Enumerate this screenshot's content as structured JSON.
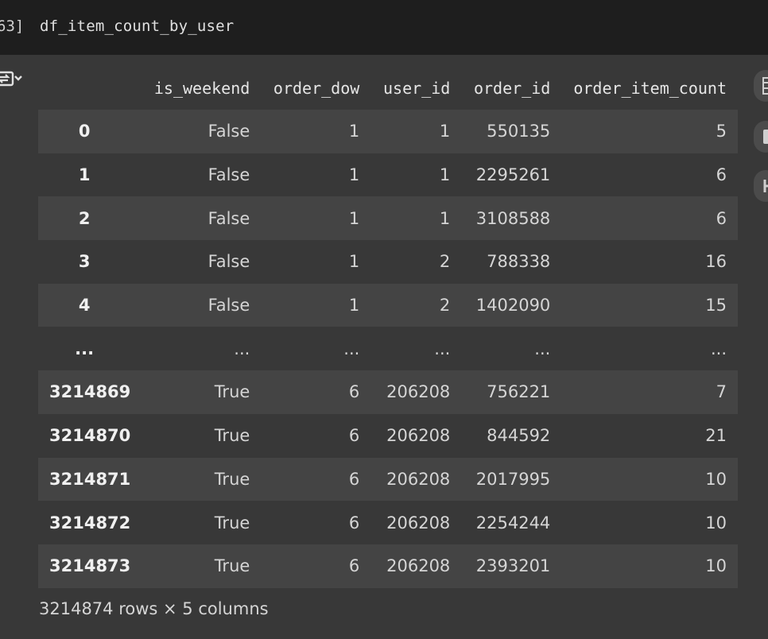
{
  "cell": {
    "exec_count": "63]",
    "code": "df_item_count_by_user"
  },
  "icons": {
    "output_toggle": "output-view-icon",
    "right_side": [
      "table-icon",
      "notebook-icon",
      "chart-icon"
    ]
  },
  "table": {
    "columns": [
      "",
      "is_weekend",
      "order_dow",
      "user_id",
      "order_id",
      "order_item_count"
    ],
    "rows": [
      [
        "0",
        "False",
        "1",
        "1",
        "550135",
        "5"
      ],
      [
        "1",
        "False",
        "1",
        "1",
        "2295261",
        "6"
      ],
      [
        "2",
        "False",
        "1",
        "1",
        "3108588",
        "6"
      ],
      [
        "3",
        "False",
        "1",
        "2",
        "788338",
        "16"
      ],
      [
        "4",
        "False",
        "1",
        "2",
        "1402090",
        "15"
      ],
      [
        "...",
        "...",
        "...",
        "...",
        "...",
        "..."
      ],
      [
        "3214869",
        "True",
        "6",
        "206208",
        "756221",
        "7"
      ],
      [
        "3214870",
        "True",
        "6",
        "206208",
        "844592",
        "21"
      ],
      [
        "3214871",
        "True",
        "6",
        "206208",
        "2017995",
        "10"
      ],
      [
        "3214872",
        "True",
        "6",
        "206208",
        "2254244",
        "10"
      ],
      [
        "3214873",
        "True",
        "6",
        "206208",
        "2393201",
        "10"
      ]
    ]
  },
  "shape_info": "3214874 rows × 5 columns"
}
